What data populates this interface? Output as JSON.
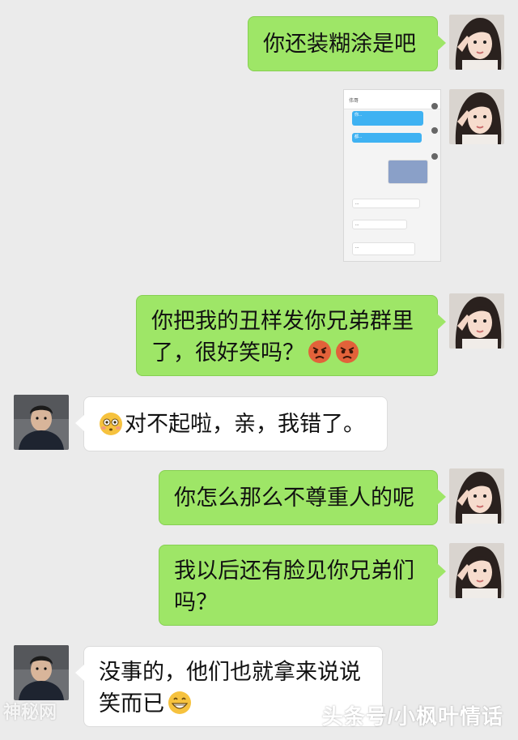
{
  "messages": [
    {
      "text": "你还装糊涂是吧"
    },
    {
      "screenshot": {
        "title": "伟哥",
        "lines": [
          "你...",
          "都...",
          "...",
          "...",
          "...",
          "..."
        ]
      }
    },
    {
      "text": "你把我的丑样发你兄弟群里\n了，很好笑吗？"
    },
    {
      "text": "对不起啦，亲，我错了。"
    },
    {
      "text": "你怎么那么不尊重人的呢"
    },
    {
      "text": "我以后还有脸见你兄弟们\n吗？"
    },
    {
      "text": "没事的，他们也就拿来说说\n笑而已"
    }
  ],
  "watermark": "头条号/小枫叶情话",
  "watermark_left": "神秘网",
  "colors": {
    "sent_bubble": "#9ee667",
    "received_bubble": "#ffffff",
    "background": "#ebebeb"
  }
}
